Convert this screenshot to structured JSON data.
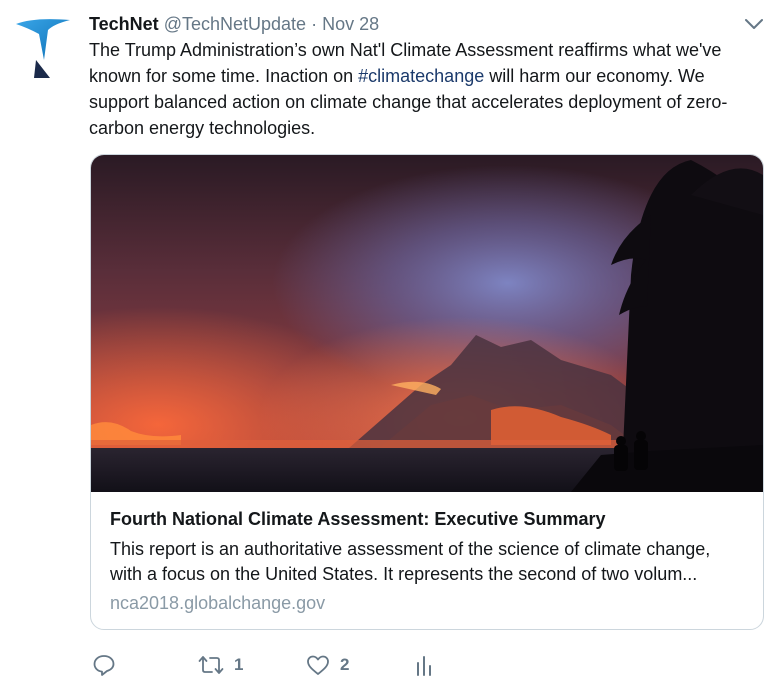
{
  "tweet": {
    "author_name": "TechNet",
    "author_handle": "@TechNetUpdate",
    "separator": "·",
    "date": "Nov 28",
    "text_before_hashtag": "The Trump Administration’s own Nat'l Climate Assessment reaffirms what we've known for some time. Inaction on ",
    "hashtag": "#climatechange",
    "text_after_hashtag": " will harm our economy. We support balanced action on climate change that accelerates deployment of zero-carbon energy technologies."
  },
  "card": {
    "title": "Fourth National Climate Assessment: Executive Summary",
    "description_line1": "This report is an authoritative assessment of the science of climate change,",
    "description_line2": "with a focus on the United States. It represents the second of two volum...",
    "url": "nca2018.globalchange.gov"
  },
  "actions": {
    "reply_icon": "reply-icon",
    "retweet_icon": "retweet-icon",
    "retweet_count": "1",
    "like_icon": "heart-icon",
    "like_count": "2",
    "analytics_icon": "analytics-icon"
  },
  "colors": {
    "text": "#14171a",
    "secondary": "#657786",
    "hashtag": "#1b3a6b",
    "url": "#8a9aa6",
    "border": "#ccd6dd",
    "logo_blue": "#1a8fd8",
    "logo_navy": "#1b2a4a"
  }
}
